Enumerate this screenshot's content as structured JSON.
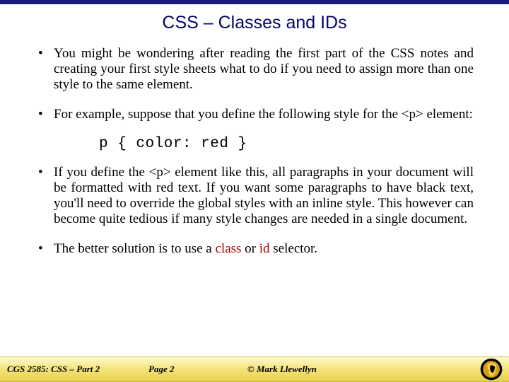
{
  "title": "CSS – Classes and IDs",
  "bullets": {
    "b1": "You might be wondering after reading the first part of the CSS notes and creating your first style sheets what to do if you need to assign more than one style to the same element.",
    "b2_pre": "For example, suppose that you define the following style for the <p> element:",
    "code": "p { color: red }",
    "b3_pre": "If you define the <p> element like this, all paragraphs in your document will be formatted with red text. If you want some paragraphs to have black text, you'll need to override the global styles with an inline style.  This however can become quite tedious if many style changes are needed in a single document.",
    "b4_pre": "The better solution is to use a ",
    "b4_class": "class",
    "b4_mid": " or ",
    "b4_id": "id",
    "b4_post": " selector."
  },
  "footer": {
    "left": "CGS 2585: CSS – Part 2",
    "page": "Page 2",
    "copy": "© Mark Llewellyn"
  }
}
